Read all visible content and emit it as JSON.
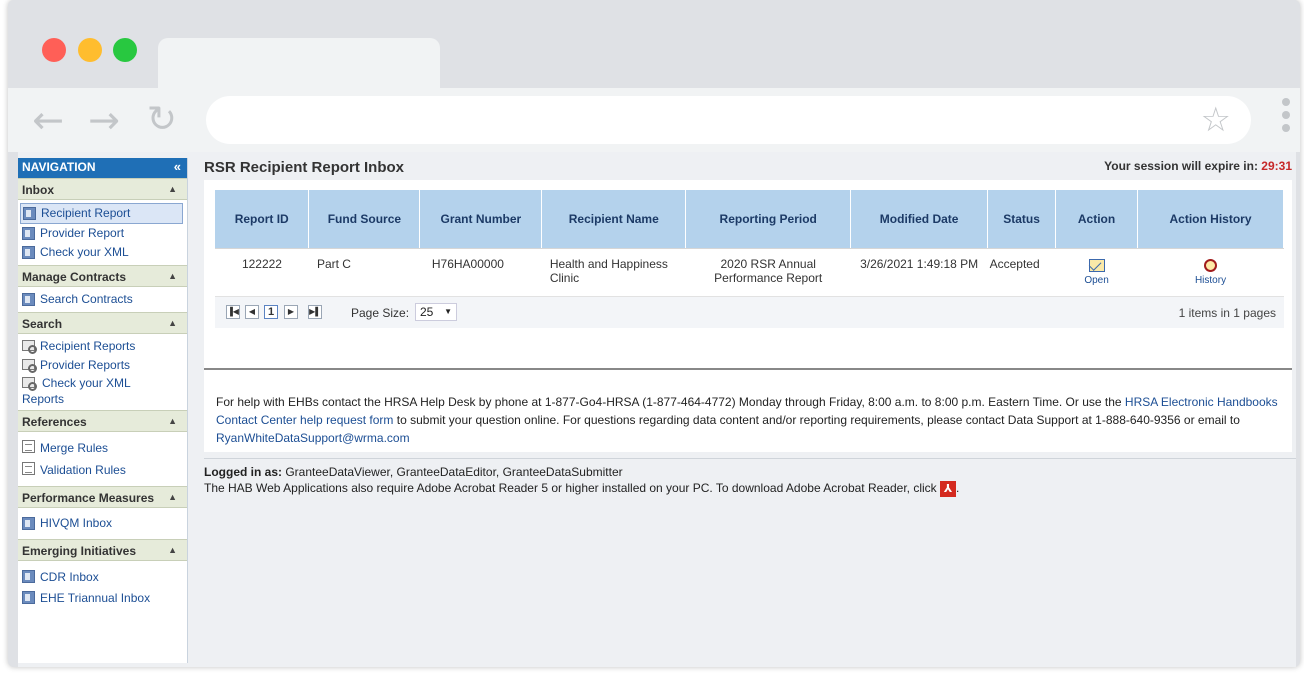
{
  "navigation": {
    "title": "NAVIGATION",
    "collapse": "«",
    "sections": [
      {
        "title": "Inbox",
        "items": [
          {
            "label": "Recipient Report"
          },
          {
            "label": "Provider Report"
          },
          {
            "label": "Check your XML"
          }
        ]
      },
      {
        "title": "Manage Contracts",
        "items": [
          {
            "label": "Search Contracts"
          }
        ]
      },
      {
        "title": "Search",
        "items": [
          {
            "label": "Recipient Reports"
          },
          {
            "label": "Provider Reports"
          },
          {
            "label": "Check your XML Reports"
          }
        ]
      },
      {
        "title": "References",
        "items": [
          {
            "label": "Merge Rules"
          },
          {
            "label": "Validation Rules"
          }
        ]
      },
      {
        "title": "Performance Measures",
        "items": [
          {
            "label": "HIVQM Inbox"
          }
        ]
      },
      {
        "title": "Emerging Initiatives",
        "items": [
          {
            "label": "CDR Inbox"
          },
          {
            "label": "EHE Triannual Inbox"
          }
        ]
      }
    ]
  },
  "page": {
    "title": "RSR Recipient Report Inbox",
    "session_label": "Your session will expire in:",
    "session_time": "29:31"
  },
  "table": {
    "headers": [
      "Report ID",
      "Fund Source",
      "Grant Number",
      "Recipient Name",
      "Reporting Period",
      "Modified Date",
      "Status",
      "Action",
      "Action History"
    ],
    "rows": [
      {
        "report_id": "122222",
        "fund_source": "Part C",
        "grant_number": "H76HA00000",
        "recipient_name": "Health and Happiness Clinic",
        "reporting_period": "2020 RSR Annual Performance Report",
        "modified_date": "3/26/2021 1:49:18 PM",
        "status": "Accepted",
        "action": "Open",
        "history": "History"
      }
    ]
  },
  "pager": {
    "current_page": "1",
    "page_size_label": "Page Size:",
    "page_size": "25",
    "items_info": "1 items in 1 pages"
  },
  "help": {
    "part1": "For help with EHBs contact the HRSA Help Desk by phone at 1-877-Go4-HRSA (1-877-464-4772) Monday through Friday, 8:00 a.m. to 8:00 p.m. Eastern Time. Or use the ",
    "link1": "HRSA Electronic Handbooks Contact Center help request form",
    "part2": " to submit your question online. For questions regarding data content and/or reporting requirements, please contact Data Support at 1-888-640-9356 or email to ",
    "link2": "RyanWhiteDataSupport@wrma.com"
  },
  "footer": {
    "logged_label": "Logged in as:",
    "logged_roles": " GranteeDataViewer, GranteeDataEditor, GranteeDataSubmitter",
    "acrobat_text": "The HAB Web Applications also require Adobe Acrobat Reader 5 or higher installed on your PC. To download Adobe Acrobat Reader, click",
    "acrobat_period": "."
  },
  "colors": {
    "accent": "#1f6fb6",
    "header_bg": "#b4d2ec",
    "section_bg": "#e6ebda",
    "timer": "#c62828"
  }
}
